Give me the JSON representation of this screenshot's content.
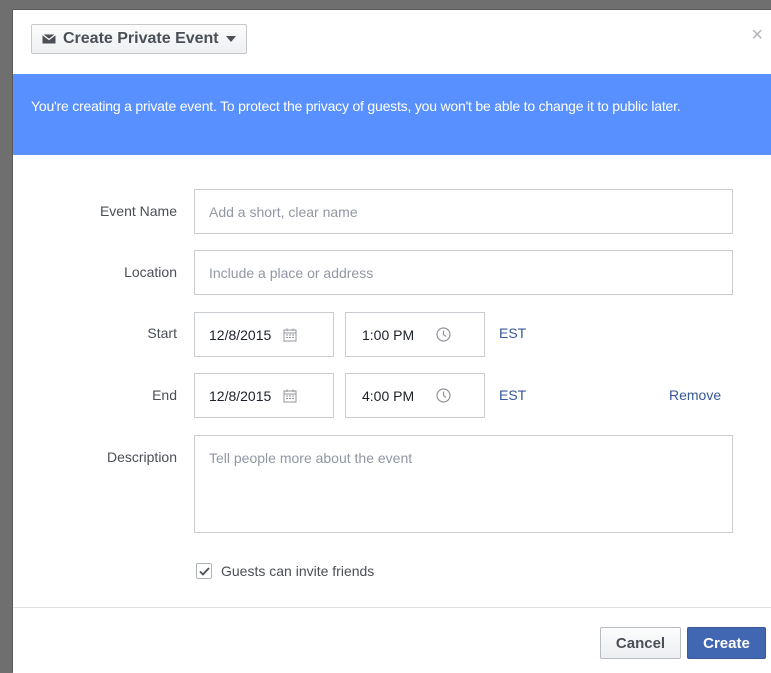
{
  "header": {
    "event_type_label": "Create Private Event",
    "close_symbol": "×"
  },
  "banner": {
    "text": "You're creating a private event. To protect the privacy of guests, you won't be able to change it to public later."
  },
  "form": {
    "event_name": {
      "label": "Event Name",
      "placeholder": "Add a short, clear name",
      "value": ""
    },
    "location": {
      "label": "Location",
      "placeholder": "Include a place or address",
      "value": ""
    },
    "start": {
      "label": "Start",
      "date": "12/8/2015",
      "time": "1:00 PM",
      "timezone": "EST"
    },
    "end": {
      "label": "End",
      "date": "12/8/2015",
      "time": "4:00 PM",
      "timezone": "EST",
      "remove_label": "Remove"
    },
    "description": {
      "label": "Description",
      "placeholder": "Tell people more about the event",
      "value": ""
    },
    "guests_invite": {
      "label": "Guests can invite friends",
      "checked": true
    }
  },
  "footer": {
    "cancel_label": "Cancel",
    "create_label": "Create"
  },
  "colors": {
    "banner": "#5890ff",
    "primary_button": "#4267b2",
    "link": "#365899"
  },
  "icons": [
    "envelope-icon",
    "caret-down-icon",
    "close-icon",
    "calendar-icon",
    "clock-icon",
    "checkmark-icon"
  ]
}
